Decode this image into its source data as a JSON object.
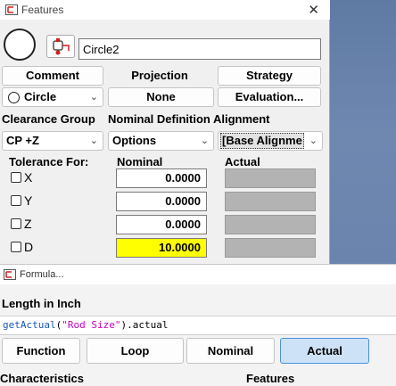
{
  "features_window": {
    "title": "Features",
    "close": "✕",
    "feature_name": "Circle2",
    "buttons": {
      "comment": "Comment",
      "projection": "Projection",
      "strategy": "Strategy"
    },
    "row2": {
      "type": "Circle",
      "projection_value": "None",
      "evaluation": "Evaluation..."
    },
    "labels": {
      "clearance_group": "Clearance Group",
      "nominal_definition_alignment": "Nominal Definition Alignment"
    },
    "row3": {
      "clearance_group_value": "CP +Z",
      "nominal_definition_value": "Options",
      "alignment_value": "[Base Alignme"
    },
    "tolerance": {
      "header_for": "Tolerance For:",
      "header_nominal": "Nominal",
      "header_actual": "Actual",
      "rows": [
        {
          "label": "X",
          "nominal": "0.0000"
        },
        {
          "label": "Y",
          "nominal": "0.0000"
        },
        {
          "label": "Z",
          "nominal": "0.0000"
        },
        {
          "label": "D",
          "nominal": "10.0000"
        }
      ]
    },
    "colors": {
      "highlight": "#ffff00",
      "actual_bg": "#b3b3b3"
    }
  },
  "formula_window": {
    "title": "Formula...",
    "subtitle": "Length in Inch",
    "formula": {
      "fn": "getActual",
      "open": "(",
      "arg": "\"Rod Size\"",
      "rest": ").actual"
    },
    "buttons": {
      "function": "Function",
      "loop": "Loop",
      "nominal": "Nominal",
      "actual": "Actual"
    },
    "active_button": "Actual",
    "footer": {
      "characteristics": "Characteristics",
      "features": "Features"
    }
  }
}
